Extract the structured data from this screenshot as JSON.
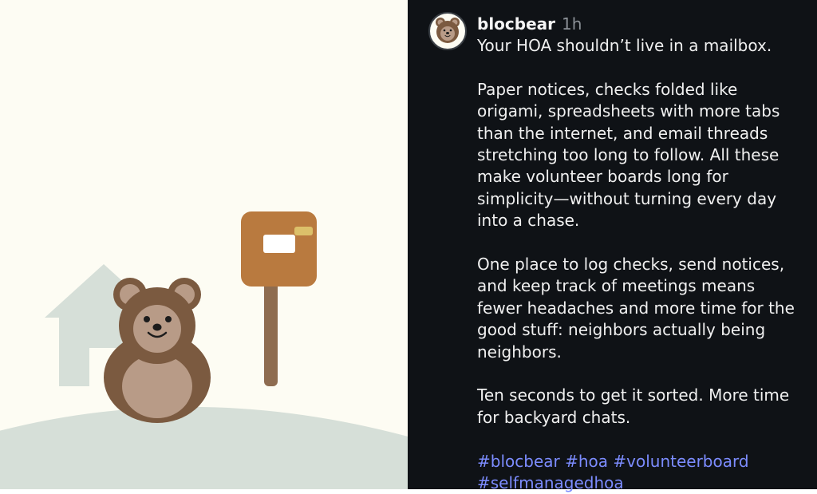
{
  "post": {
    "username": "blocbear",
    "time": "1h",
    "paragraphs": [
      "Your HOA shouldn’t live in a mailbox.",
      "Paper notices, checks folded like origami, spreadsheets with more tabs than the internet, and email threads stretching too long to follow. All these make volunteer boards long for simplicity—without turning every day into a chase.",
      "One place to log checks, send notices, and keep track of meetings means fewer headaches and more time for the good stuff: neighbors actually being neighbors.",
      "Ten seconds to get it sorted. More time for backyard chats."
    ],
    "hashtags": [
      "#blocbear",
      "#hoa",
      "#volunteerboard",
      "#selfmanagedhoa"
    ]
  },
  "illustration": {
    "icons": [
      "house-icon",
      "bear-icon",
      "mailbox-icon",
      "ground-hill"
    ]
  },
  "colors": {
    "panel_bg": "#0f1216",
    "image_bg": "#fdfcf3",
    "hashtag": "#7c8cff",
    "bear_brown": "#7b5a40",
    "mailbox": "#b97a3f",
    "house": "#d6dfd8"
  }
}
